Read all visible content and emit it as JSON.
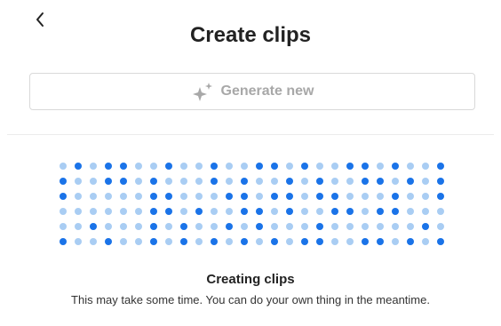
{
  "header": {
    "title": "Create clips",
    "back_icon": "chevron-left-icon"
  },
  "generate": {
    "label": "Generate new",
    "icon": "sparkle-icon",
    "enabled": false
  },
  "progress": {
    "title": "Creating clips",
    "subtitle": "This may take some time. You can do your own thing in the meantime.",
    "colors": {
      "light": "#a9cdf3",
      "dark": "#1a73e8"
    },
    "grid": [
      "01011001001001101001101001",
      "10011010001010010100110101",
      "10000011000110110110001001",
      "00000011010011010011011000",
      "00100010100101000100000010",
      "10010010101010101100110101"
    ]
  }
}
